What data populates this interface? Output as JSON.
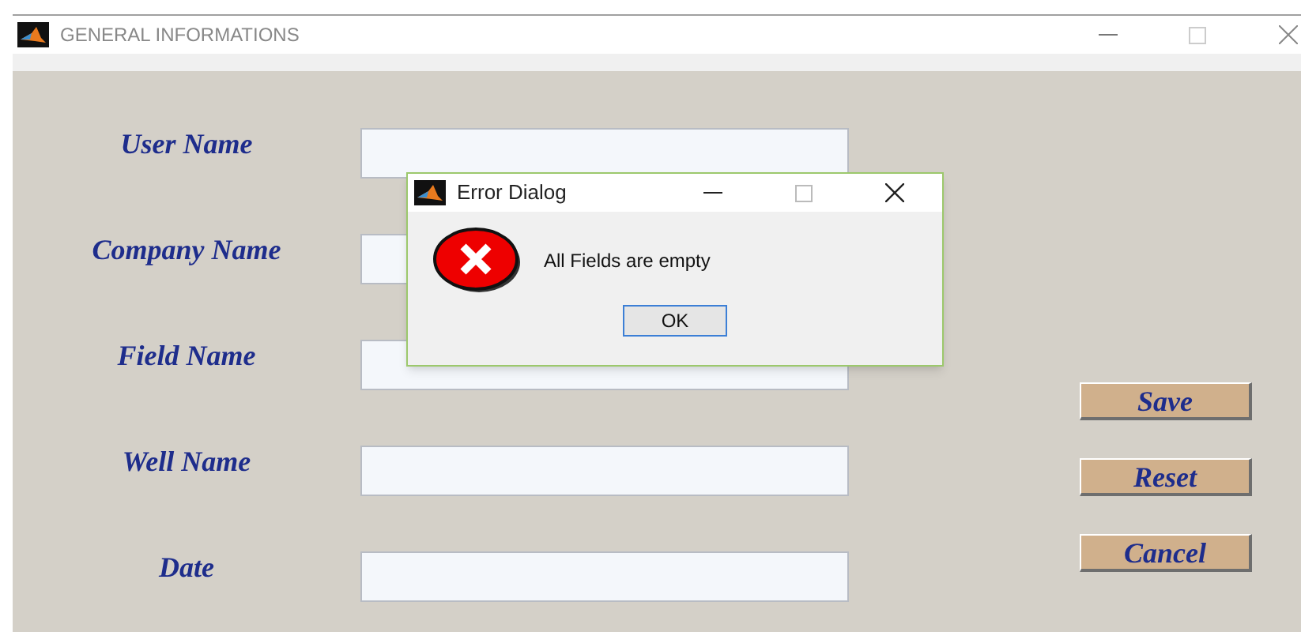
{
  "window": {
    "title": "GENERAL INFORMATIONS"
  },
  "fields": [
    {
      "label": "User Name"
    },
    {
      "label": "Company Name"
    },
    {
      "label": "Field Name"
    },
    {
      "label": "Well Name"
    },
    {
      "label": "Date"
    }
  ],
  "buttons": [
    "Save",
    "Reset",
    "Cancel"
  ],
  "dialog": {
    "title": "Error Dialog",
    "message": "All Fields are empty",
    "button": "OK"
  }
}
